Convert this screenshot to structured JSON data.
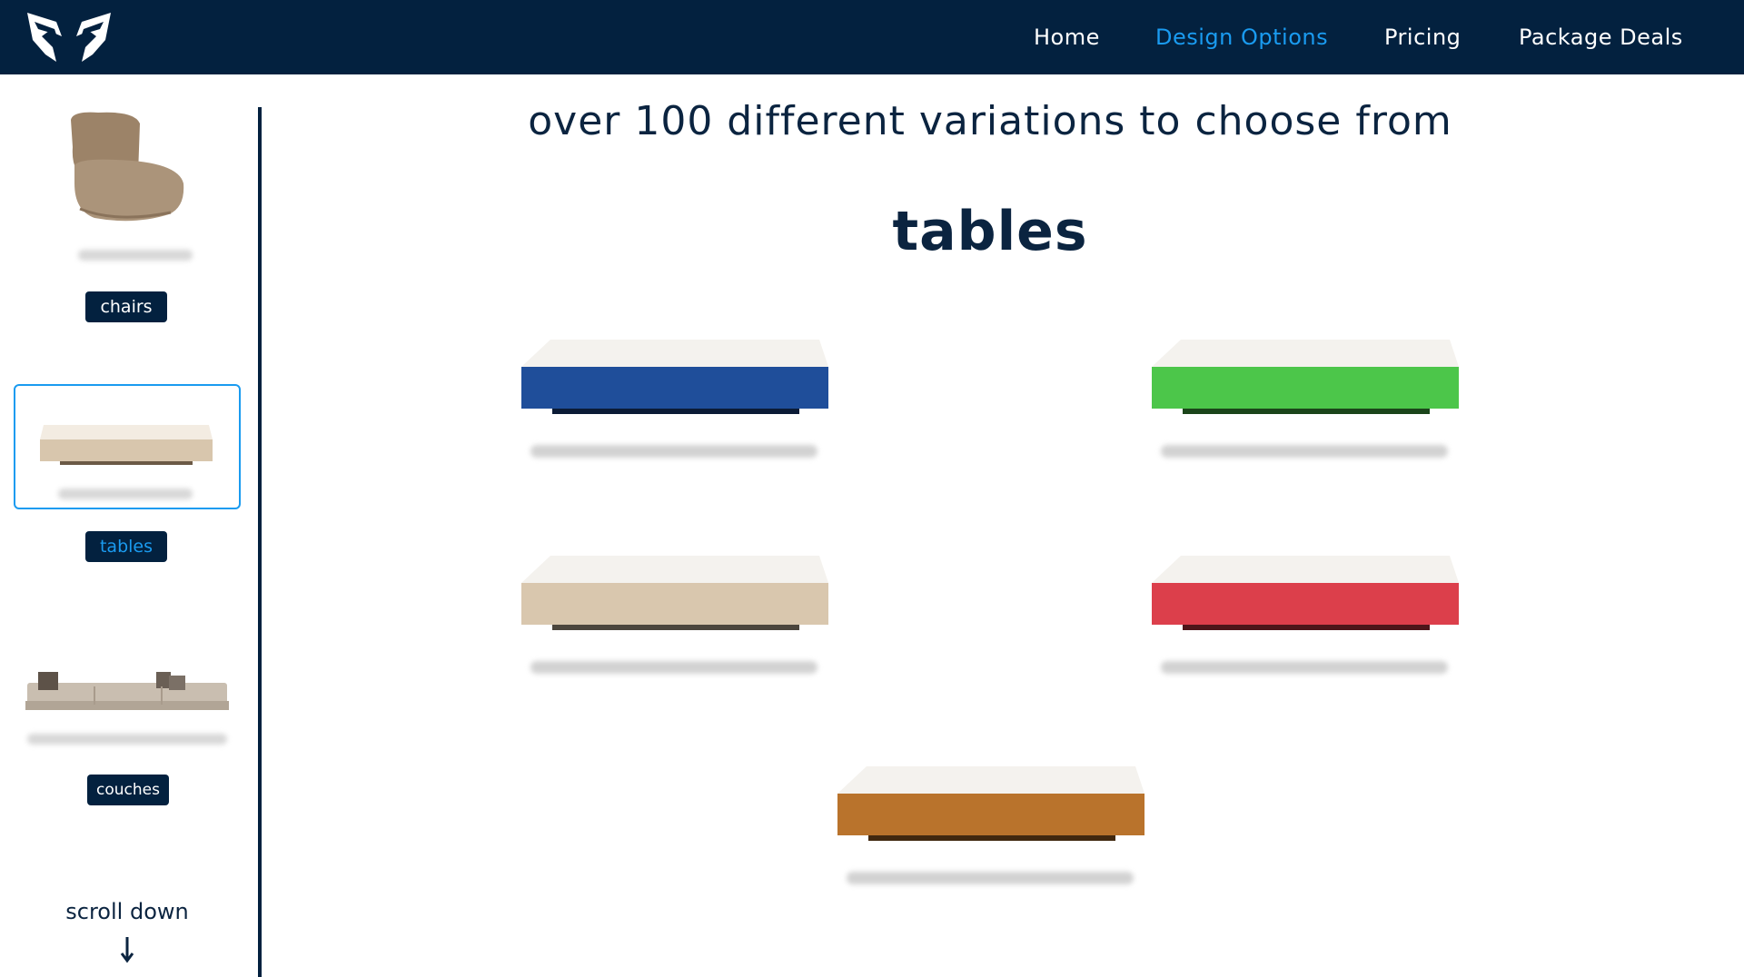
{
  "nav": {
    "home": "Home",
    "design_options": "Design Options",
    "pricing": "Pricing",
    "package_deals": "Package Deals"
  },
  "sidebar": {
    "items": [
      {
        "label": "chairs",
        "icon": "chair-icon"
      },
      {
        "label": "tables",
        "icon": "table-icon",
        "selected": true
      },
      {
        "label": "couches",
        "icon": "couch-icon"
      }
    ],
    "scroll_hint": "scroll down"
  },
  "main": {
    "headline": "over 100 different variations to choose from",
    "category_title": "tables",
    "tables": [
      {
        "color": "#1f4e9a"
      },
      {
        "color": "#4cc64a"
      },
      {
        "color": "#d9c7ae"
      },
      {
        "color": "#dc3f4b"
      },
      {
        "color": "#b9732c"
      }
    ]
  },
  "colors": {
    "nav_bg": "#03213f",
    "accent": "#1a9bf0",
    "text_dark": "#0b2440"
  }
}
